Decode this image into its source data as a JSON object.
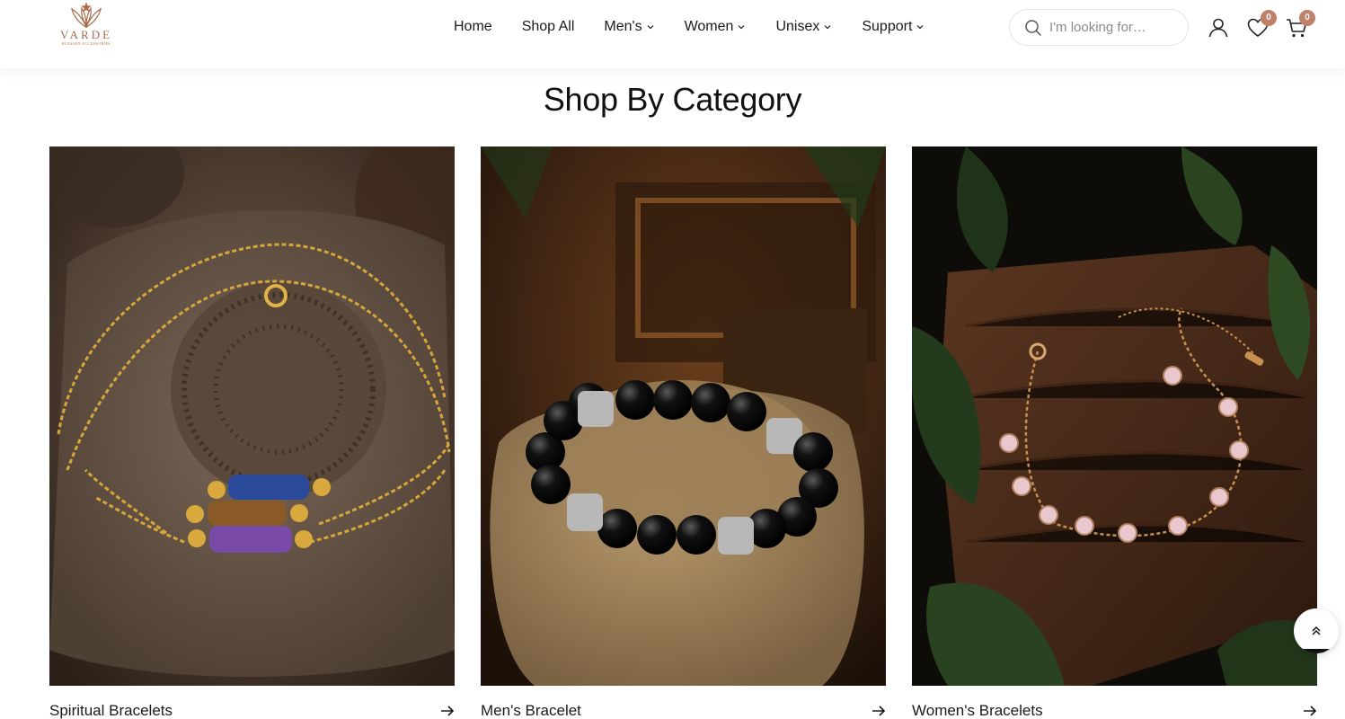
{
  "brand": {
    "name": "VARDE",
    "tagline": "BLESSED ACCESSORIES",
    "color": "#a86a4a"
  },
  "nav": [
    {
      "label": "Home",
      "dropdown": false
    },
    {
      "label": "Shop All",
      "dropdown": false
    },
    {
      "label": "Men's",
      "dropdown": true
    },
    {
      "label": "Women",
      "dropdown": true
    },
    {
      "label": "Unisex",
      "dropdown": true
    },
    {
      "label": "Support",
      "dropdown": true
    }
  ],
  "search": {
    "placeholder": "I'm looking for…",
    "icon": "search-icon"
  },
  "header_icons": {
    "account": "user-icon",
    "wishlist": {
      "icon": "heart-icon",
      "count": "0"
    },
    "cart": {
      "icon": "cart-icon",
      "count": "0"
    }
  },
  "badge_color": "#c0806a",
  "section": {
    "title": "Shop By Category",
    "categories": [
      {
        "label": "Spiritual Bracelets",
        "icon": "arrow-right-icon"
      },
      {
        "label": "Men's Bracelet",
        "icon": "arrow-right-icon"
      },
      {
        "label": "Women's Bracelets",
        "icon": "arrow-right-icon"
      }
    ]
  },
  "scroll_top": {
    "icon": "double-chevron-up-icon"
  }
}
